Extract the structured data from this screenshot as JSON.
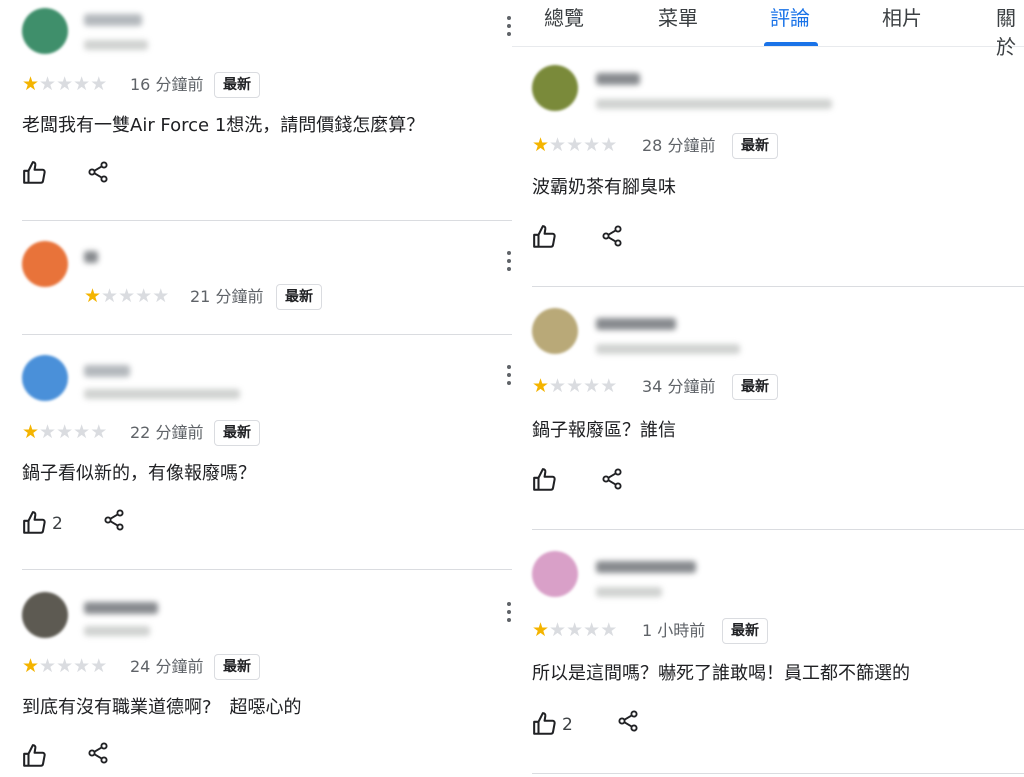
{
  "tabs": [
    {
      "label": "總覽",
      "active": false
    },
    {
      "label": "菜單",
      "active": false
    },
    {
      "label": "評論",
      "active": true
    },
    {
      "label": "相片",
      "active": false
    },
    {
      "label": "關於",
      "active": false
    }
  ],
  "badge_label": "最新",
  "accent_color": "#1a73e8",
  "star_color": "#f4b400",
  "left_reviews": [
    {
      "rating": 1,
      "time": "16 分鐘前",
      "text": "老闆我有一雙Air Force 1想洗，請問價錢怎麼算？",
      "likes": "",
      "avatar_color": "#3f8f6b"
    },
    {
      "rating": 1,
      "time": "21 分鐘前",
      "text": "",
      "likes": "",
      "avatar_color": "#e8733a"
    },
    {
      "rating": 1,
      "time": "22 分鐘前",
      "text": "鍋子看似新的，有像報廢嗎？",
      "likes": "2",
      "avatar_color": "#4a90d9"
    },
    {
      "rating": 1,
      "time": "24 分鐘前",
      "text": "到底有沒有職業道德啊?　超噁心的",
      "likes": "",
      "avatar_color": "#5d5a52"
    }
  ],
  "right_reviews": [
    {
      "rating": 1,
      "time": "28 分鐘前",
      "text": "波霸奶茶有腳臭味",
      "likes": "",
      "avatar_color": "#7a8a3a"
    },
    {
      "rating": 1,
      "time": "34 分鐘前",
      "text": "鍋子報廢區？誰信",
      "likes": "",
      "avatar_color": "#b9a978"
    },
    {
      "rating": 1,
      "time": "1 小時前",
      "text": "所以是這間嗎？嚇死了誰敢喝！員工都不篩選的",
      "likes": "2",
      "avatar_color": "#d9a0c8"
    }
  ]
}
